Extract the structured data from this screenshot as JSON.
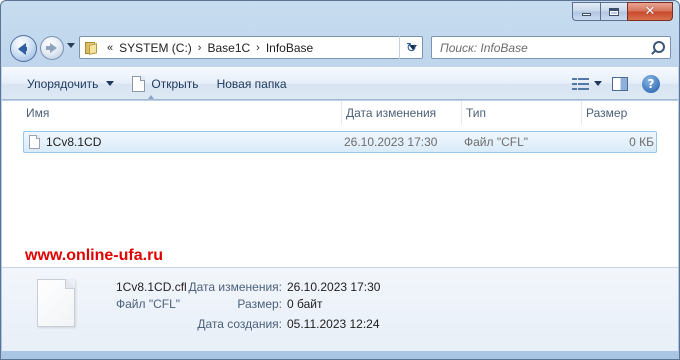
{
  "window": {
    "minimize_icon": "minimize-icon",
    "maximize_icon": "maximize-icon",
    "close_glyph": "✕"
  },
  "navigation": {
    "breadcrumbs": [
      {
        "label": "SYSTEM (C:)"
      },
      {
        "label": "Base1C"
      },
      {
        "label": "InfoBase"
      }
    ],
    "overflow_glyph": "«",
    "separator_glyph": "›",
    "refresh_glyph": "↻"
  },
  "search": {
    "placeholder": "Поиск: InfoBase"
  },
  "toolbar": {
    "organize_label": "Упорядочить",
    "open_label": "Открыть",
    "new_folder_label": "Новая папка",
    "help_glyph": "?"
  },
  "columns": {
    "name": "Имя",
    "date": "Дата изменения",
    "type": "Тип",
    "size": "Размер"
  },
  "files": [
    {
      "name": "1Cv8.1CD",
      "date": "26.10.2023 17:30",
      "type": "Файл \"CFL\"",
      "size": "0 КБ",
      "selected": true
    }
  ],
  "watermark": "www.online-ufa.ru",
  "details": {
    "name": "1Cv8.1CD.cfl",
    "type": "Файл \"CFL\"",
    "modified_label": "Дата изменения:",
    "modified_value": "26.10.2023 17:30",
    "size_label": "Размер:",
    "size_value": "0 байт",
    "created_label": "Дата создания:",
    "created_value": "05.11.2023 12:24"
  },
  "colors": {
    "selection_border": "#99c7ea",
    "watermark": "#e00000",
    "close_button": "#c8462a"
  }
}
